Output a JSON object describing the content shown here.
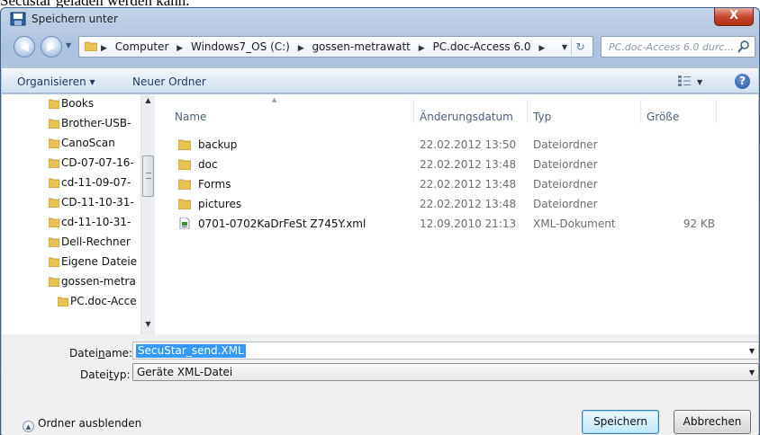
{
  "background_text": "Secustar geladen werden kann.",
  "window": {
    "title": "Speichern unter",
    "close_label": "X"
  },
  "navigation": {
    "back_glyph": "◀",
    "forward_glyph": "▶",
    "breadcrumb": [
      "Computer",
      "Windows7_OS (C:)",
      "gossen-metrawatt",
      "PC.doc-Access 6.0"
    ],
    "search_placeholder": "PC.doc-Access 6.0 durc...",
    "refresh_glyph": "↻"
  },
  "toolbar": {
    "organize_label": "Organisieren ▾",
    "new_folder_label": "Neuer Ordner",
    "help_label": "?"
  },
  "sidebar": {
    "items": [
      {
        "label": "Books"
      },
      {
        "label": "Brother-USB-"
      },
      {
        "label": "CanoScan"
      },
      {
        "label": "CD-07-07-16-"
      },
      {
        "label": "cd-11-09-07-"
      },
      {
        "label": "CD-11-10-31-"
      },
      {
        "label": "cd-11-10-31-"
      },
      {
        "label": "Dell-Rechner"
      },
      {
        "label": "Eigene Dateie"
      },
      {
        "label": "gossen-metra"
      },
      {
        "label": "PC.doc-Acce"
      }
    ]
  },
  "file_list": {
    "columns": {
      "name": "Name",
      "date": "Änderungsdatum",
      "type": "Typ",
      "size": "Größe"
    },
    "rows": [
      {
        "name": "backup",
        "date": "22.02.2012 13:50",
        "type": "Dateiordner",
        "size": "",
        "kind": "folder"
      },
      {
        "name": "doc",
        "date": "22.02.2012 13:48",
        "type": "Dateiordner",
        "size": "",
        "kind": "folder"
      },
      {
        "name": "Forms",
        "date": "22.02.2012 13:48",
        "type": "Dateiordner",
        "size": "",
        "kind": "folder"
      },
      {
        "name": "pictures",
        "date": "22.02.2012 13:48",
        "type": "Dateiordner",
        "size": "",
        "kind": "folder"
      },
      {
        "name": "0701-0702KaDrFeSt Z745Y.xml",
        "date": "12.09.2010 21:13",
        "type": "XML-Dokument",
        "size": "92 KB",
        "kind": "xml"
      }
    ]
  },
  "form": {
    "filename_label_pre": "Datei",
    "filename_label_u": "n",
    "filename_label_post": "ame:",
    "filename_value": "SecuStar_send.XML",
    "filetype_label_pre": "Datei",
    "filetype_label_u": "t",
    "filetype_label_post": "yp:",
    "filetype_value": "Geräte XML-Datei",
    "hide_folders_label": "Ordner ausblenden",
    "save_label": "Speichern",
    "cancel_label": "Abbrechen"
  },
  "colors": {
    "folder": "#e8c253",
    "accent": "#3399ff",
    "close": "#c7462c"
  }
}
